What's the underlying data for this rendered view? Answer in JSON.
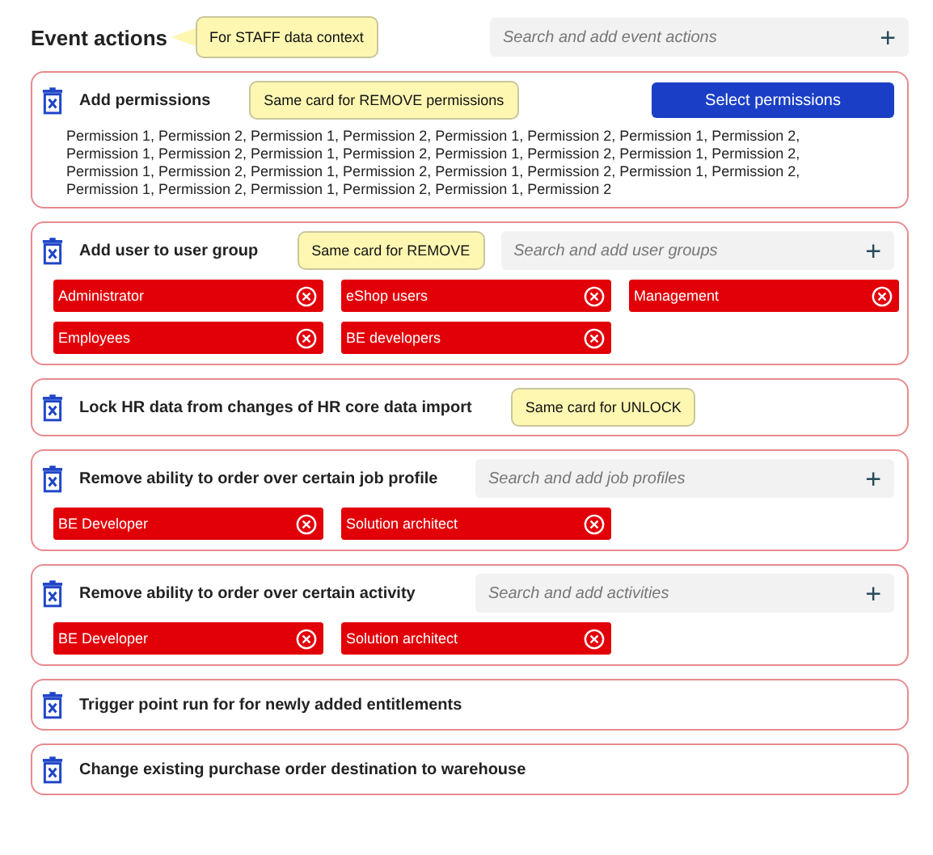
{
  "header": {
    "title": "Event actions",
    "note": "For STAFF data context",
    "search": {
      "placeholder": "Search and add event actions",
      "add": "+"
    }
  },
  "cards": [
    {
      "title": "Add permissions",
      "note": "Same card for REMOVE permissions",
      "button": "Select permissions",
      "text": "Permission 1, Permission 2, Permission 1, Permission 2, Permission 1, Permission 2, Permission 1, Permission 2, Permission 1, Permission 2, Permission 1, Permission 2, Permission 1, Permission 2, Permission 1, Permission 2, Permission 1, Permission 2, Permission 1, Permission 2, Permission 1, Permission 2, Permission 1, Permission 2, Permission 1, Permission 2, Permission 1, Permission 2, Permission 1, Permission 2"
    },
    {
      "title": "Add user to user group",
      "note": "Same card for REMOVE",
      "search": {
        "placeholder": "Search and add user groups",
        "add": "+"
      },
      "chips": [
        "Administrator",
        "eShop users",
        "Management",
        "Employees",
        "BE developers"
      ]
    },
    {
      "title": "Lock HR data from changes of HR core data import",
      "note": "Same card for UNLOCK"
    },
    {
      "title": "Remove ability to order over certain job profile",
      "search": {
        "placeholder": "Search and add job profiles",
        "add": "+"
      },
      "chips": [
        "BE Developer",
        "Solution architect"
      ]
    },
    {
      "title": "Remove ability to order over certain activity",
      "search": {
        "placeholder": "Search and add activities",
        "add": "+"
      },
      "chips": [
        "BE Developer",
        "Solution architect"
      ]
    },
    {
      "title": "Trigger point run for for newly added entitlements"
    },
    {
      "title": "Change existing purchase order destination to warehouse"
    }
  ]
}
